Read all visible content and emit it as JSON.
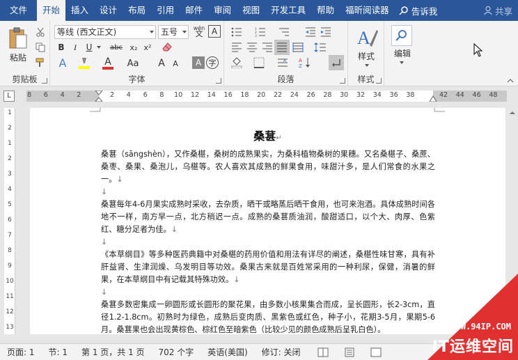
{
  "menu": {
    "items": [
      "文件",
      "开始",
      "插入",
      "设计",
      "布局",
      "引用",
      "邮件",
      "审阅",
      "视图",
      "开发工具",
      "帮助",
      "福昕阅读器"
    ],
    "active_index": 1,
    "search_label": "告诉我",
    "share_label": "共享",
    "bar_color": "#2b579a"
  },
  "ribbon": {
    "clipboard": {
      "label": "剪贴板",
      "paste_label": "粘贴"
    },
    "font": {
      "label": "字体",
      "font_name": "等线 (西文正文)",
      "font_size": "五号",
      "pinyin_label": "wén",
      "bold": "B",
      "italic": "I",
      "underline": "U",
      "strike": "abc",
      "subscript": "x₂",
      "superscript": "x²",
      "change_case": "Aa",
      "grow": "A",
      "shrink": "A"
    },
    "paragraph": {
      "label": "段落"
    },
    "styles": {
      "label": "样式",
      "button_label": "样式"
    },
    "editing": {
      "button_label": "编辑"
    }
  },
  "ruler": {
    "corner": "L",
    "marks": [
      "8",
      "6",
      "4",
      "2",
      "",
      "2",
      "4",
      "6",
      "8",
      "10",
      "12",
      "14",
      "16",
      "18",
      "20",
      "22",
      "24",
      "26",
      "28",
      "30",
      "32",
      "34",
      "36",
      "38",
      "",
      "42",
      "44",
      "46",
      "48"
    ]
  },
  "vruler": {
    "marks": [
      "1",
      "2",
      "1",
      "2",
      "3",
      "4",
      "5",
      "6",
      "7",
      "8",
      "9",
      "10",
      "11",
      "12",
      "13"
    ]
  },
  "document": {
    "title": "桑葚",
    "paragraphs": [
      "桑葚（sāngshèn），又作桑椹，桑树的成熟果实，为桑科植物桑树的果穗。又名桑椹子、桑蔗、桑枣、桑果、桑泡儿，乌椹等。农人喜欢其成熟的鲜果食用，味甜汁多，是人们常食的水果之一。",
      "",
      "桑葚每年4-6月果实成熟时采收，去杂质，晒干或略蒸后晒干食用，也可来泡酒。具体成熟时间各地不一样，南方早一点，北方稍迟一点。成熟的桑葚质油润，酸甜适口，以个大、肉厚、色紫红、糖分足者为佳。",
      "",
      "《本草纲目》等多种医药典籍中对桑椹的药用价值和用法有详尽的阐述，桑椹性味甘寒，具有补肝益肾、生津润燥、乌发明目等功效。桑果古来就是百姓常采用的一种利尿，保健，消暑的鲜果，在本草纲目中有记载其特殊功效。",
      "",
      "桑葚多数密集成一卵圆形或长圆形的聚花果，由多数小核果集合而成，呈长圆形，长2-3cm，直径1.2-1.8cm。初熟时为绿色，成熟后变肉质、黑紫色或红色，种子小，花期3-5月，果期5-6月。桑葚果也会出现黄棕色、棕红色至暗紫色（比较少见的颜色成熟后呈乳白色）。"
    ],
    "paragraph_mark": "↵",
    "line_break_mark": "↓"
  },
  "status": {
    "page": "页面: 1",
    "section": "节: 1",
    "page_of": "第 1 页，共 1 页",
    "word_count": "702 个字",
    "language": "英语(美国)",
    "track_changes": "修订: 关闭"
  },
  "watermark": {
    "url": "WWW.94IP.COM",
    "brand": "IT运维空间",
    "color": "#e03030"
  }
}
